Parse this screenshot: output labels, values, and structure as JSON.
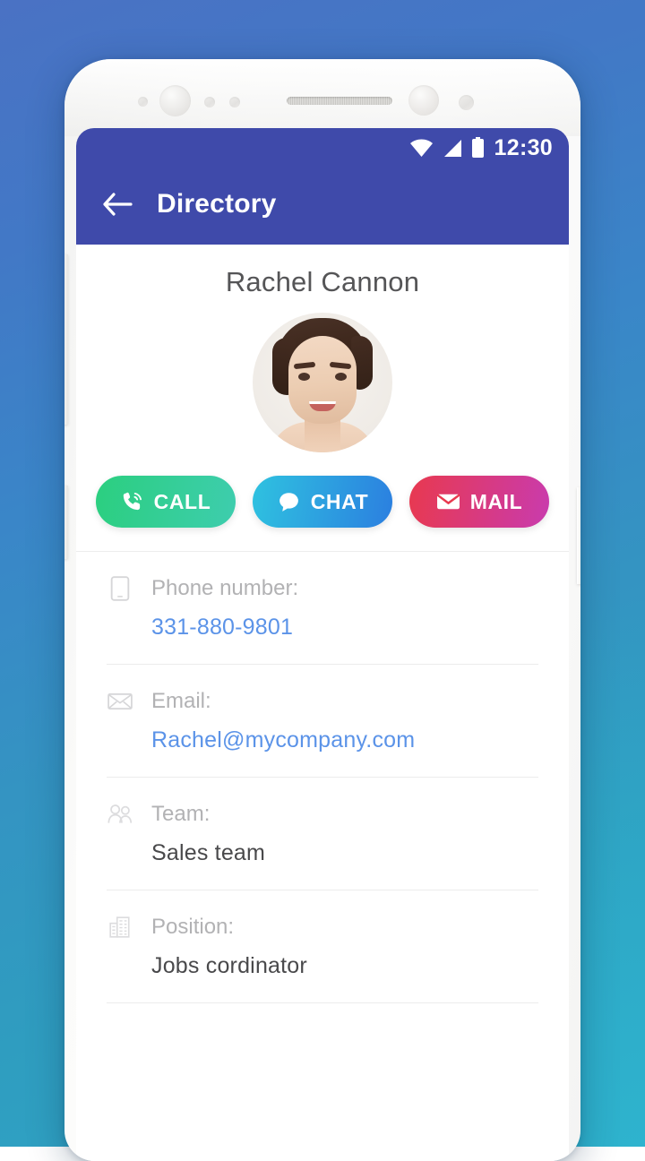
{
  "wallpaper": {
    "gradient_from": "#4a72c4",
    "gradient_to": "#2fa6c6"
  },
  "device": {
    "body_color": "#ffffff",
    "hardware": {
      "front_camera": "front-camera",
      "earpiece": "earpiece-speaker",
      "volume_rocker": "volume-rocker",
      "assistant_button": "assistant-button",
      "power_button": "power-button"
    }
  },
  "statusbar": {
    "wifi_icon": "wifi-icon",
    "signal_icon": "cell-signal-icon",
    "battery_icon": "battery-full-icon",
    "time": "12:30"
  },
  "appbar": {
    "back_icon": "back-arrow-icon",
    "title": "Directory",
    "background": "#3f4aaa"
  },
  "profile": {
    "name": "Rachel Cannon",
    "avatar_alt": "contact-photo"
  },
  "actions": [
    {
      "id": "call",
      "label": "CALL",
      "icon": "phone-icon",
      "from": "#2bcf7f",
      "to": "#3ecdae"
    },
    {
      "id": "chat",
      "label": "CHAT",
      "icon": "chat-bubble-icon",
      "from": "#2fc2e0",
      "to": "#2b7fe0"
    },
    {
      "id": "mail",
      "label": "MAIL",
      "icon": "envelope-icon",
      "from": "#e8394f",
      "to": "#c93bae"
    }
  ],
  "details": [
    {
      "key": "phone",
      "icon": "mobile-phone-icon",
      "label": "Phone number:",
      "value": "331-880-9801",
      "value_style": "link"
    },
    {
      "key": "email",
      "icon": "envelope-outline-icon",
      "label": "Email:",
      "value": "Rachel@mycompany.com",
      "value_style": "link"
    },
    {
      "key": "team",
      "icon": "people-icon",
      "label": "Team:",
      "value": "Sales team",
      "value_style": "plain"
    },
    {
      "key": "position",
      "icon": "building-icon",
      "label": "Position:",
      "value": "Jobs cordinator",
      "value_style": "plain"
    }
  ],
  "colors": {
    "link": "#5b93e8",
    "label_muted": "#b2b2b4",
    "value_text": "#49494b",
    "name_text": "#555557",
    "divider": "#ececec"
  }
}
